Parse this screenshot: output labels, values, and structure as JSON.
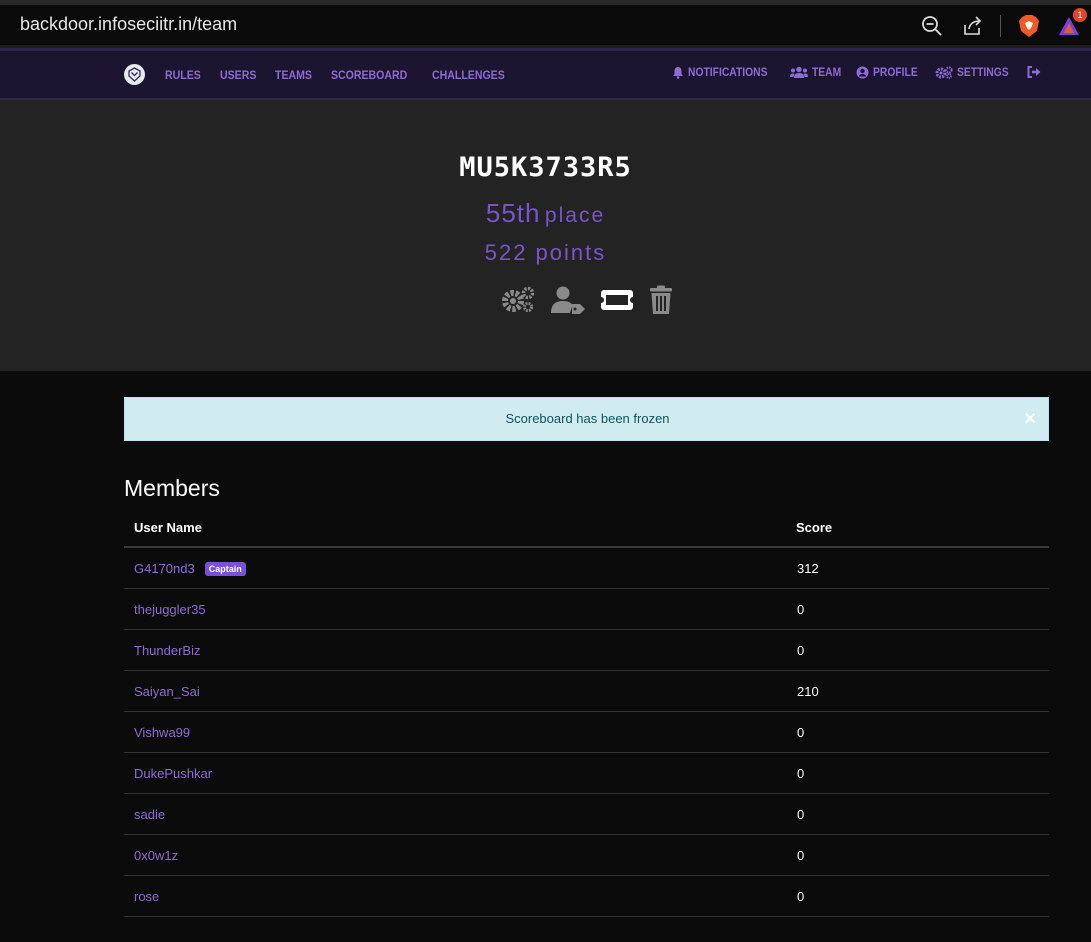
{
  "browser": {
    "url": "backdoor.infoseciitr.in/team",
    "alert_count": "1"
  },
  "nav": {
    "links": [
      "RULES",
      "USERS",
      "TEAMS",
      "SCOREBOARD",
      "CHALLENGES"
    ],
    "right": [
      {
        "label": "NOTIFICATIONS",
        "icon": "bell-icon"
      },
      {
        "label": "TEAM",
        "icon": "users-icon"
      },
      {
        "label": "PROFILE",
        "icon": "user-circle-icon"
      },
      {
        "label": "SETTINGS",
        "icon": "cogs-icon"
      }
    ],
    "logout_icon": "sign-out-icon"
  },
  "team": {
    "name": "MU5K3733R5",
    "place_num": "55th",
    "place_label": "place",
    "points": "522 points"
  },
  "alert": {
    "text": "Scoreboard has been frozen",
    "close": "×"
  },
  "members": {
    "title": "Members",
    "headers": {
      "name": "User Name",
      "score": "Score"
    },
    "captain_badge": "Captain",
    "rows": [
      {
        "name": "G4170nd3",
        "score": "312",
        "captain": true
      },
      {
        "name": "thejuggler35",
        "score": "0"
      },
      {
        "name": "ThunderBiz",
        "score": "0"
      },
      {
        "name": "Saiyan_Sai",
        "score": "210"
      },
      {
        "name": "Vishwa99",
        "score": "0"
      },
      {
        "name": "DukePushkar",
        "score": "0"
      },
      {
        "name": "sadie",
        "score": "0"
      },
      {
        "name": "0x0w1z",
        "score": "0"
      },
      {
        "name": "rose",
        "score": "0"
      }
    ]
  },
  "colors": {
    "accent": "#7a55c8",
    "nav_bg": "#1b1530",
    "jumbo_bg": "#232323",
    "alert_bg": "#d1ecf1",
    "badge": "#7b4fdb"
  }
}
